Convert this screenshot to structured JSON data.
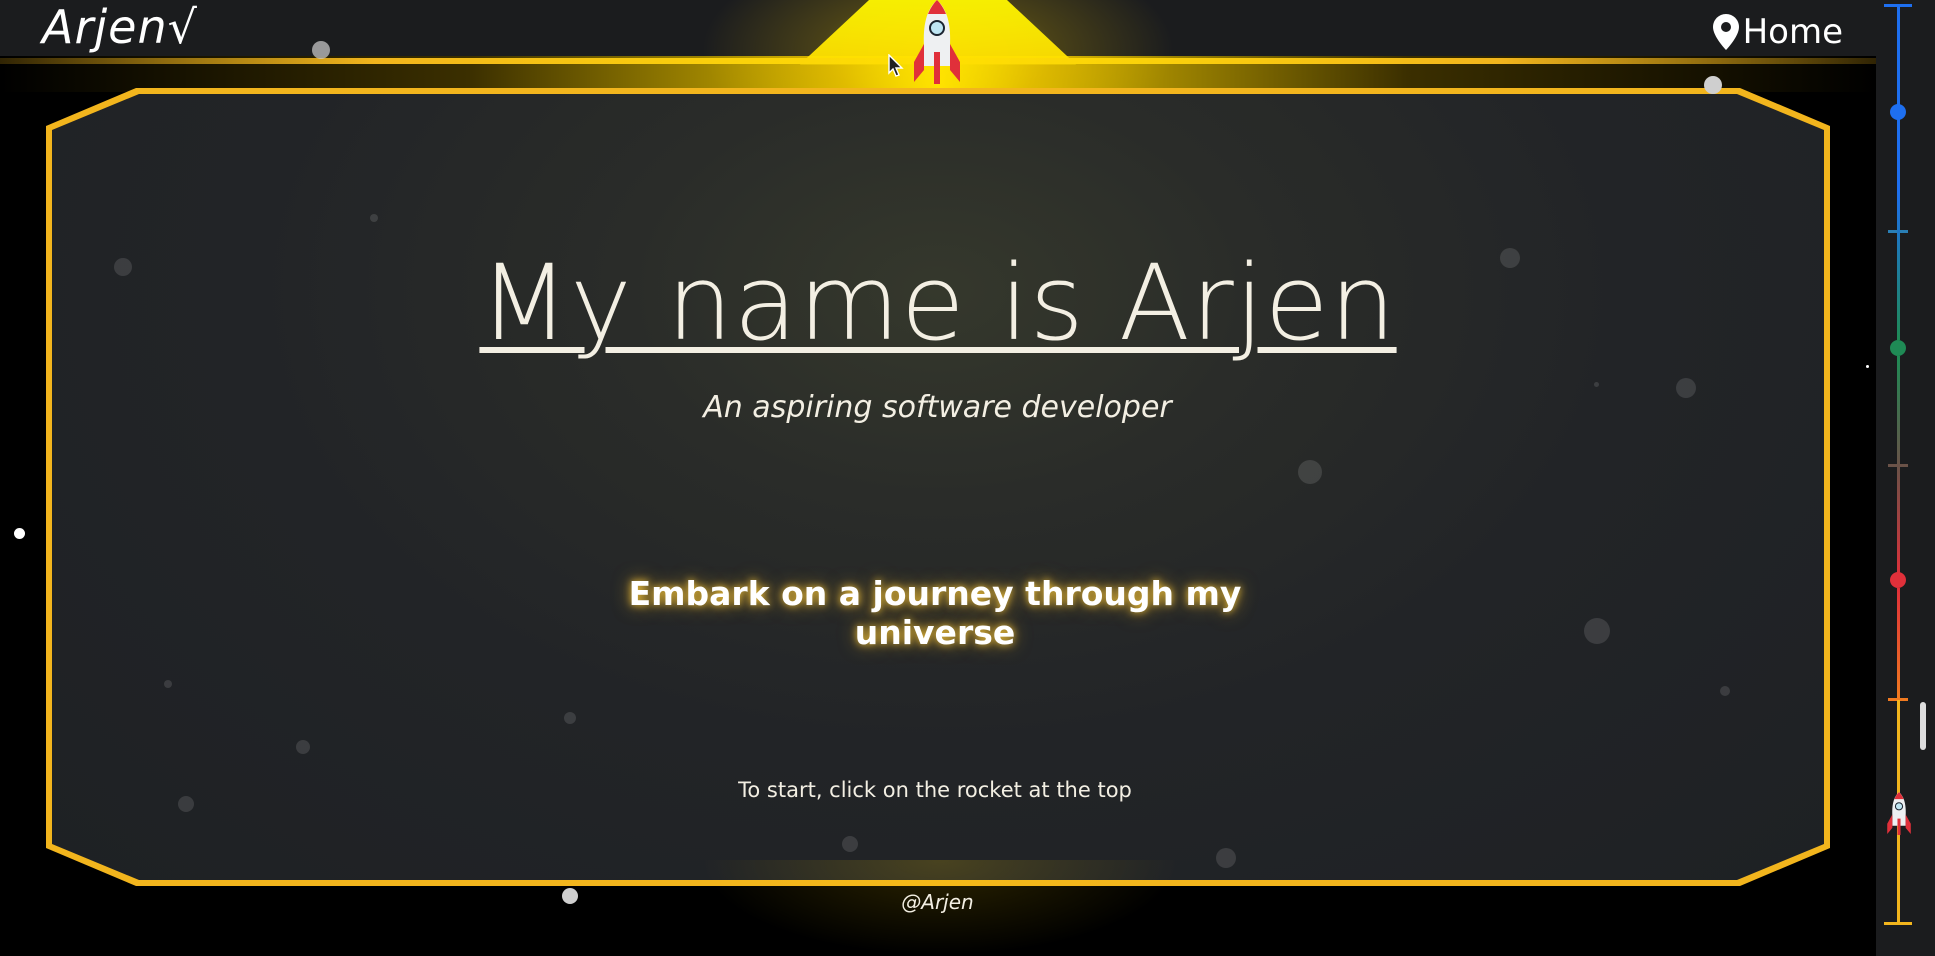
{
  "header": {
    "logo": "Arjen√",
    "location_label": "Home"
  },
  "hero": {
    "title": "My name is Arjen",
    "subtitle": "An aspiring software developer",
    "cta": "Embark on a journey through my universe",
    "hint": "To start, click on the rocket at the top"
  },
  "footer": {
    "credit": "@Arjen"
  },
  "icons": {
    "location": "map-pin-icon",
    "rocket": "rocket-icon"
  },
  "colors": {
    "accent": "#f2b51d",
    "beam": "#ffe500",
    "panel_bg": "#222427",
    "timeline_blue": "#1e6ff0",
    "timeline_green": "#1f8a55",
    "timeline_red": "#e0303a",
    "timeline_orange": "#f2b51d"
  }
}
